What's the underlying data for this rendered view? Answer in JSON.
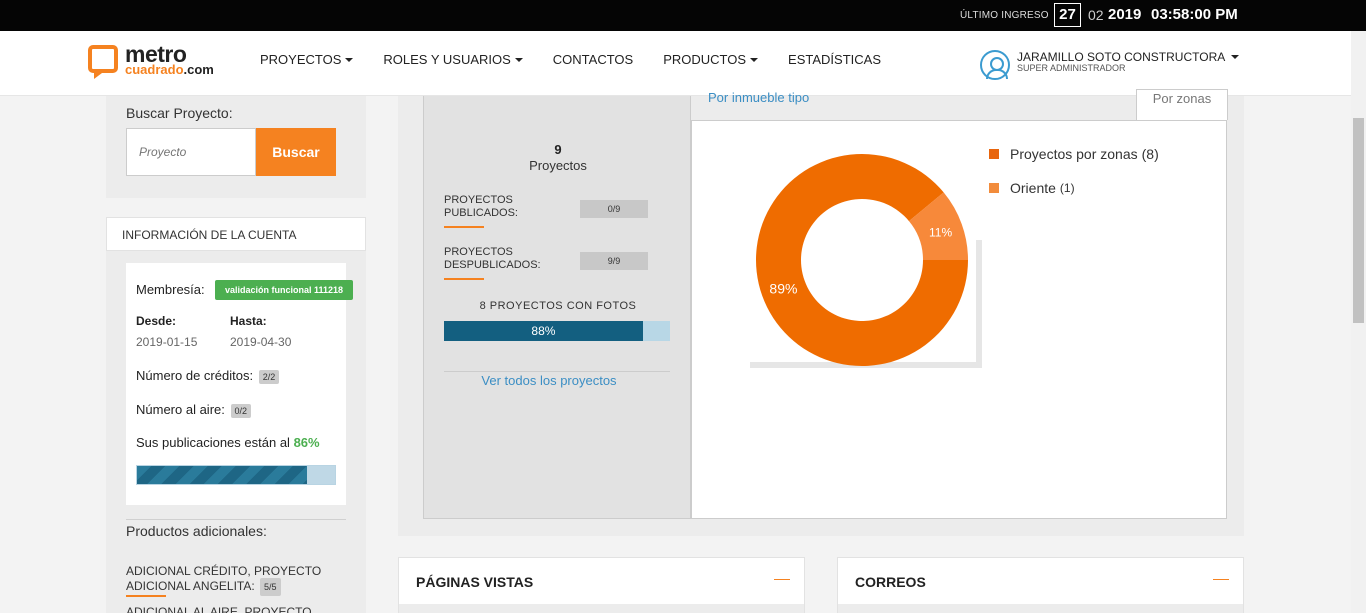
{
  "topbar": {
    "last_login_label": "ÚLTIMO INGRESO",
    "day": "27",
    "month": "02",
    "year": "2019",
    "time": "03:58:00 PM"
  },
  "header": {
    "logo_metro": "metro",
    "logo_cuadrado": "cuadrado",
    "logo_com": ".com",
    "nav": [
      {
        "label": "PROYECTOS",
        "dropdown": true
      },
      {
        "label": "ROLES Y USUARIOS",
        "dropdown": true
      },
      {
        "label": "CONTACTOS",
        "dropdown": false
      },
      {
        "label": "PRODUCTOS",
        "dropdown": true
      },
      {
        "label": "ESTADÍSTICAS",
        "dropdown": false
      }
    ],
    "user_name": "JARAMILLO SOTO CONSTRUCTORA",
    "user_role": "SUPER ADMINISTRADOR"
  },
  "search": {
    "label": "Buscar Proyecto:",
    "placeholder": "Proyecto",
    "button": "Buscar"
  },
  "account": {
    "title": "INFORMACIÓN DE LA CUENTA",
    "membership_label": "Membresía:",
    "membership_value": "validación funcional 111218",
    "from_label": "Desde:",
    "from_value": "2019-01-15",
    "to_label": "Hasta:",
    "to_value": "2019-04-30",
    "credits_label": "Número de créditos:",
    "credits_value": "2/2",
    "on_air_label": "Número al aire:",
    "on_air_value": "0/2",
    "publications_label": "Sus publicaciones están al",
    "publications_pct": "86%",
    "publications_fraction": 0.86,
    "additional_title": "Productos adicionales:",
    "additional_items": [
      {
        "text": "ADICIONAL CRÉDITO, PROYECTO ADICIONAL ANGELITA:",
        "badge": "5/5"
      },
      {
        "text": "ADICIONAL AL AIRE, PROYECTO",
        "badge": ""
      }
    ]
  },
  "stats": {
    "projects_count": "9",
    "projects_label": "Proyectos",
    "published_label": "PROYECTOS PUBLICADOS:",
    "published_value": "0/9",
    "unpublished_label": "PROYECTOS DESPUBLICADOS:",
    "unpublished_value": "9/9",
    "photos_label": "8 PROYECTOS CON FOTOS",
    "photos_pct": "88%",
    "photos_fraction": 0.88,
    "view_all_link": "Ver todos los proyectos",
    "tab_by_type": "Por inmueble tipo",
    "tab_by_zone": "Por zonas"
  },
  "chart_data": {
    "type": "pie",
    "categories": [
      "Proyectos por zonas",
      "Oriente"
    ],
    "counts": [
      "(8)",
      "(1)"
    ],
    "values": [
      89,
      11
    ],
    "labels": [
      "89%",
      "11%"
    ],
    "colors": [
      "#ef6c00",
      "#f7893a"
    ],
    "legend_colors": [
      "#e8650d",
      "#f28c3c"
    ],
    "legend": "right"
  },
  "bottom": {
    "page_views": "PÁGINAS VISTAS",
    "emails": "CORREOS"
  }
}
